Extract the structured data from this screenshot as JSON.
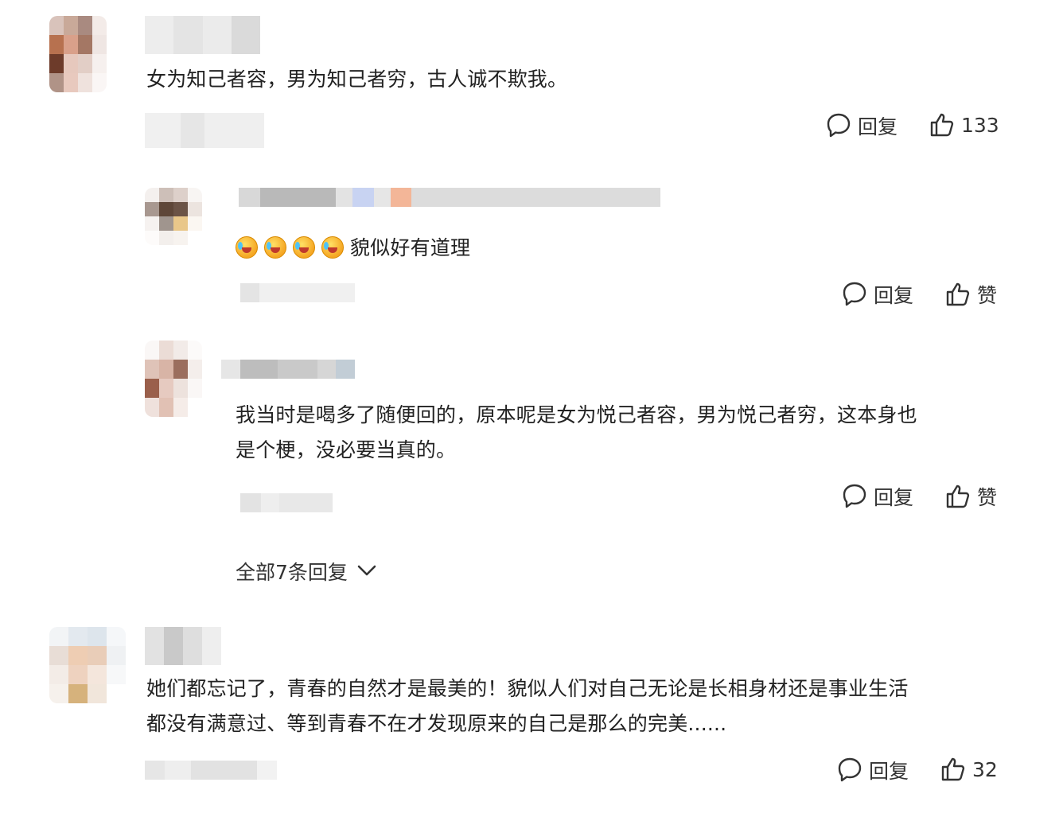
{
  "comments": [
    {
      "text": "女为知己者容，男为知己者穷，古人诚不欺我。",
      "reply_label": "回复",
      "like_count": "133"
    },
    {
      "emoji_icons": [
        "laugh-cry-emoji",
        "laugh-cry-emoji",
        "laugh-cry-emoji",
        "laugh-cry-emoji"
      ],
      "text": "貌似好有道理",
      "reply_label": "回复",
      "like_label": "赞"
    },
    {
      "text_line1": "我当时是喝多了随便回的，原本呢是女为悦己者容，男为悦己者穷，这本身也",
      "text_line2": "是个梗，没必要当真的。",
      "reply_label": "回复",
      "like_label": "赞"
    },
    {
      "text_line1": "她们都忘记了，青春的自然才是最美的！貌似人们对自己无论是长相身材还是事业生活",
      "text_line2": "都没有满意过、等到青春不在才发现原来的自己是那么的完美......",
      "reply_label": "回复",
      "like_count": "32"
    }
  ],
  "expand_replies_label": "全部7条回复",
  "icons": {
    "reply": "speech-bubble-icon",
    "like": "thumbs-up-icon",
    "expand": "chevron-down-icon"
  }
}
